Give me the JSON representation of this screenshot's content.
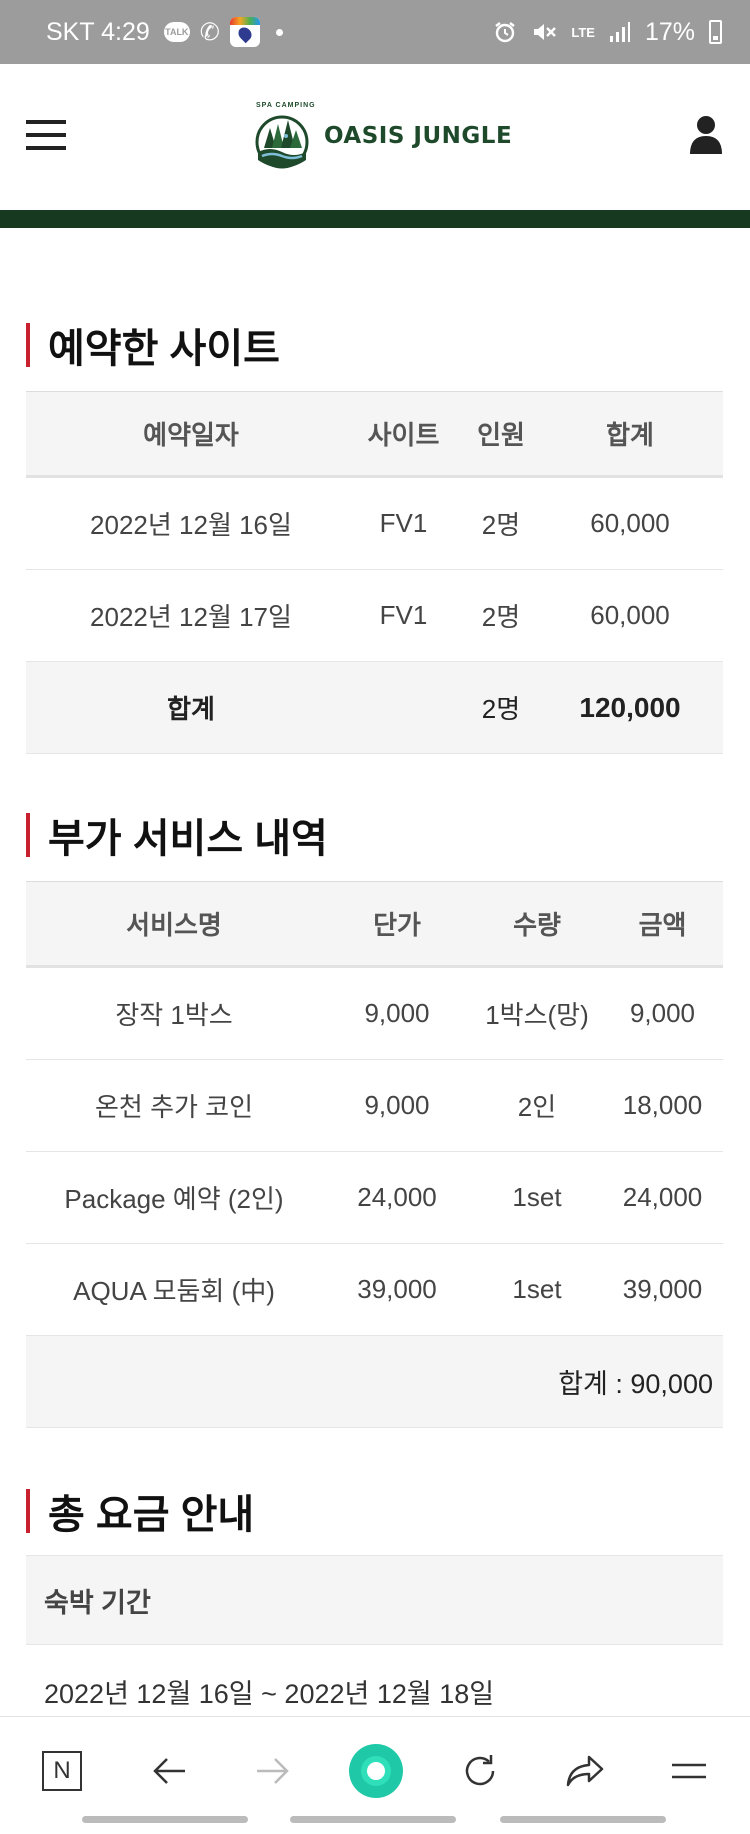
{
  "status_bar": {
    "carrier_time": "SKT 4:29",
    "talk_badge": "TALK",
    "network": "LTE",
    "battery": "17%"
  },
  "header": {
    "logo_subtitle": "SPA CAMPING",
    "logo_text": "OASIS JUNGLE"
  },
  "reservation": {
    "title": "예약한 사이트",
    "columns": [
      "예약일자",
      "사이트",
      "인원",
      "합계"
    ],
    "rows": [
      [
        "2022년 12월 16일",
        "FV1",
        "2명",
        "60,000"
      ],
      [
        "2022년 12월 17일",
        "FV1",
        "2명",
        "60,000"
      ]
    ],
    "total": {
      "label": "합계",
      "people": "2명",
      "amount": "120,000"
    }
  },
  "extras": {
    "title": "부가 서비스 내역",
    "columns": [
      "서비스명",
      "단가",
      "수량",
      "금액"
    ],
    "rows": [
      [
        "장작 1박스",
        "9,000",
        "1박스(망)",
        "9,000"
      ],
      [
        "온천 추가 코인",
        "9,000",
        "2인",
        "18,000"
      ],
      [
        "Package 예약 (2인)",
        "24,000",
        "1set",
        "24,000"
      ],
      [
        "AQUA 모둠회 (中)",
        "39,000",
        "1set",
        "39,000"
      ]
    ],
    "total": "합계 : 90,000"
  },
  "summary": {
    "title": "총 요금 안내",
    "period_label": "숙박 기간",
    "period_value": "2022년 12월 16일 ~ 2022년 12월 18일"
  },
  "bottom_nav": {
    "home_label": "N"
  },
  "colors": {
    "brand_green": "#16391f",
    "accent_red": "#c8202e",
    "nav_teal": "#1fc9a8"
  }
}
